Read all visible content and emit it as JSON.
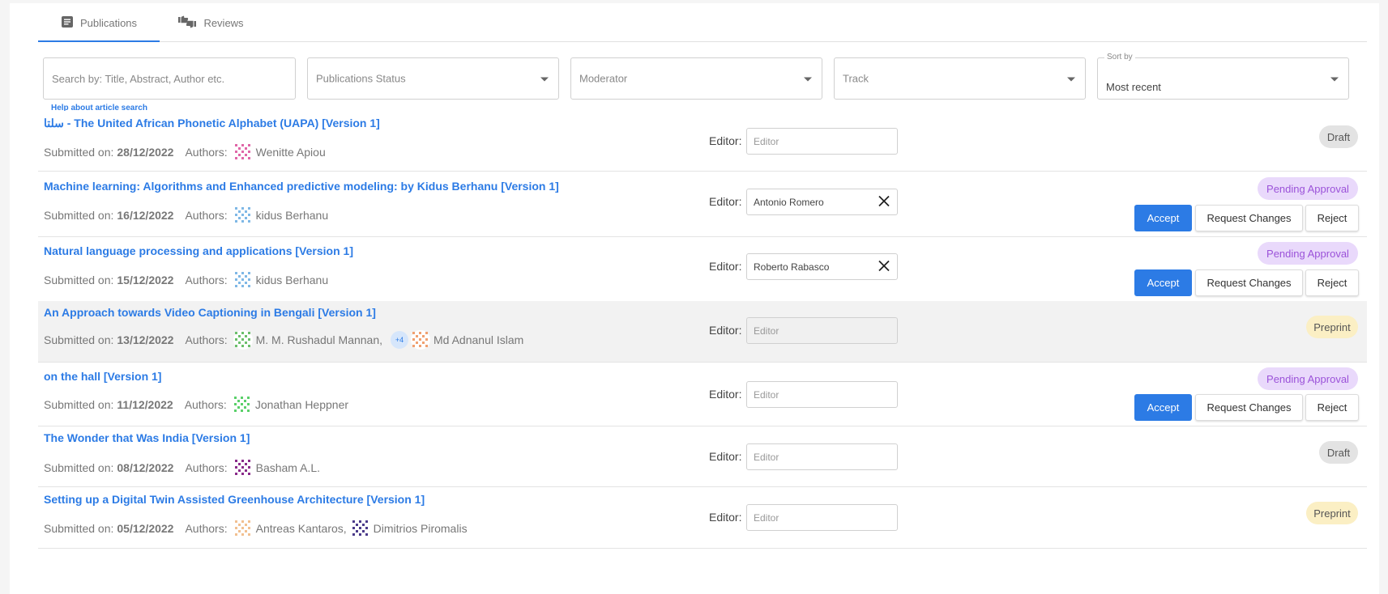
{
  "tabs": [
    {
      "label": "Publications",
      "icon": "article-icon",
      "active": true
    },
    {
      "label": "Reviews",
      "icon": "thumbs-icon",
      "active": false
    }
  ],
  "filters": {
    "search_placeholder": "Search by: Title, Abstract, Author etc.",
    "status_placeholder": "Publications Status",
    "moderator_placeholder": "Moderator",
    "track_placeholder": "Track",
    "sort_legend": "Sort by",
    "sort_value": "Most recent"
  },
  "help_link": "Help about article search",
  "labels": {
    "submitted_on": "Submitted on:",
    "authors": "Authors:",
    "editor": "Editor:",
    "editor_placeholder": "Editor",
    "accept": "Accept",
    "request_changes": "Request Changes",
    "reject": "Reject"
  },
  "colors": {
    "accent": "#2c7be5",
    "draft_bg": "#e3e3e3",
    "pending_bg": "#e9d9fb",
    "pending_text": "#9b52d9",
    "preprint_bg": "#fbefc4"
  },
  "publications": [
    {
      "title": "سلتا - The United African Phonetic Alphabet (UAPA) [Version 1]",
      "date": "28/12/2022",
      "authors": [
        {
          "name": "Wenitte Apiou",
          "color": "#e066a8"
        }
      ],
      "more": "",
      "authors2": [],
      "editor": "",
      "status": "Draft"
    },
    {
      "title": "Machine learning: Algorithms and Enhanced predictive modeling: by Kidus Berhanu [Version 1]",
      "date": "16/12/2022",
      "authors": [
        {
          "name": "kidus Berhanu",
          "color": "#7fb8e6"
        }
      ],
      "more": "",
      "authors2": [],
      "editor": "Antonio Romero",
      "status": "Pending Approval"
    },
    {
      "title": "Natural language processing and applications [Version 1]",
      "date": "15/12/2022",
      "authors": [
        {
          "name": "kidus Berhanu",
          "color": "#7fb8e6"
        }
      ],
      "more": "",
      "authors2": [],
      "editor": "Roberto Rabasco",
      "status": "Pending Approval"
    },
    {
      "title": "An Approach towards Video Captioning in Bengali [Version 1]",
      "date": "13/12/2022",
      "authors": [
        {
          "name": "M. M. Rushadul Mannan,",
          "color": "#6bbf6b"
        }
      ],
      "more": "+4",
      "authors2": [
        {
          "name": "Md Adnanul Islam",
          "color": "#f0a070"
        }
      ],
      "editor": "",
      "status": "Preprint"
    },
    {
      "title": "on the hall [Version 1]",
      "date": "11/12/2022",
      "authors": [
        {
          "name": "Jonathan Heppner",
          "color": "#5ad06a"
        }
      ],
      "more": "",
      "authors2": [],
      "editor": "",
      "status": "Pending Approval"
    },
    {
      "title": "The Wonder that Was India [Version 1]",
      "date": "08/12/2022",
      "authors": [
        {
          "name": "Basham A.L.",
          "color": "#8a2a8a"
        }
      ],
      "more": "",
      "authors2": [],
      "editor": "",
      "status": "Draft"
    },
    {
      "title": "Setting up a Digital Twin Assisted Greenhouse Architecture [Version 1]",
      "date": "05/12/2022",
      "authors": [
        {
          "name": "Antreas Kantaros,",
          "color": "#f2c090"
        },
        {
          "name": "Dimitrios Piromalis",
          "color": "#4a3a8a"
        }
      ],
      "more": "",
      "authors2": [],
      "editor": "",
      "status": "Preprint"
    }
  ]
}
